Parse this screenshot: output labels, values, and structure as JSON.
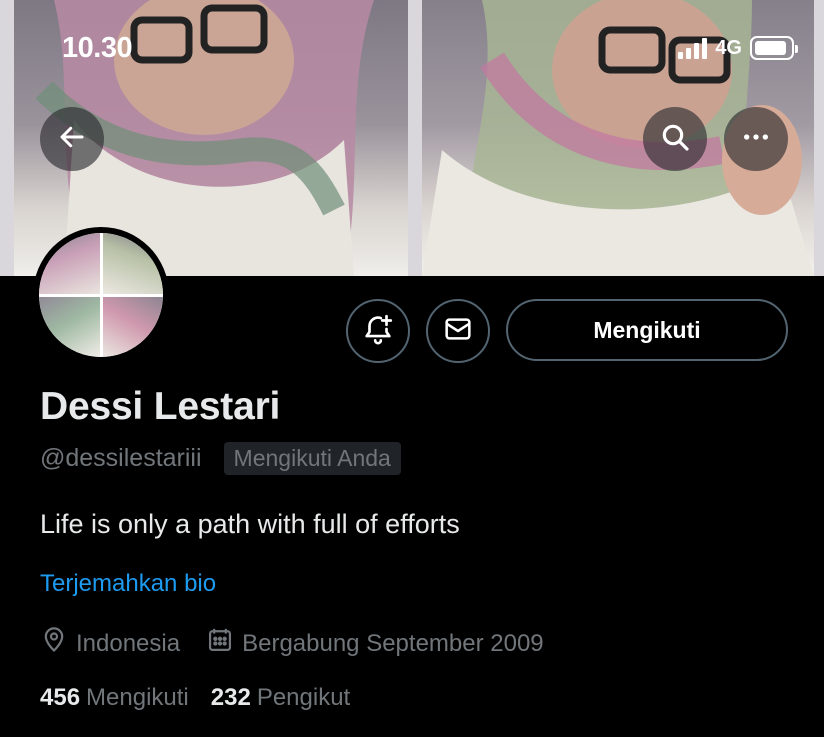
{
  "status_bar": {
    "time": "10.30",
    "network": "4G",
    "battery_level": 0.9
  },
  "header": {
    "back_icon": "arrow-left-icon",
    "search_icon": "search-icon",
    "more_icon": "more-horizontal-icon"
  },
  "actions": {
    "notify_icon": "bell-plus-icon",
    "message_icon": "envelope-icon",
    "follow_label": "Mengikuti"
  },
  "profile": {
    "name": "Dessi Lestari",
    "handle": "@dessilestariii",
    "follows_you_badge": "Mengikuti Anda",
    "bio": "Life is only a path with full of efforts",
    "translate_bio": "Terjemahkan bio",
    "location": "Indonesia",
    "joined": "Bergabung September 2009"
  },
  "stats": {
    "following_count": "456",
    "following_label": "Mengikuti",
    "followers_count": "232",
    "followers_label": "Pengikut"
  },
  "colors": {
    "accent": "#1d9bf0",
    "muted": "#71767b",
    "border": "#536471",
    "background": "#000000"
  }
}
